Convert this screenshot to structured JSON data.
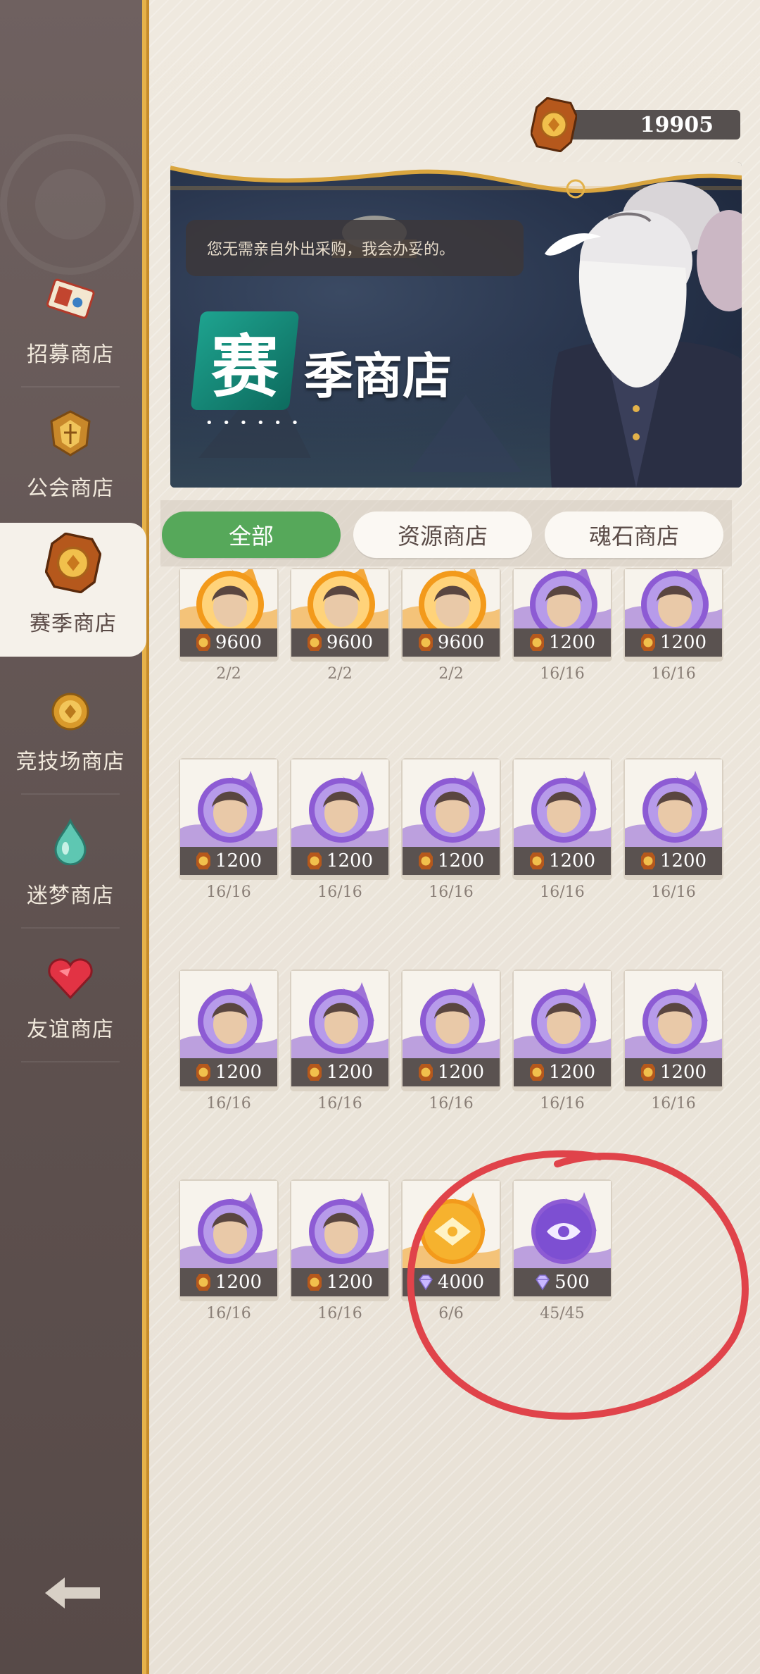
{
  "currency": {
    "amount": "19905",
    "icon": "season-coin-icon"
  },
  "sidebar": {
    "items": [
      {
        "label": "招募商店",
        "icon": "ticket-icon",
        "active": false
      },
      {
        "label": "公会商店",
        "icon": "guild-emblem-icon",
        "active": false
      },
      {
        "label": "赛季商店",
        "icon": "season-coin-icon",
        "active": true
      },
      {
        "label": "竞技场商店",
        "icon": "arena-coin-icon",
        "active": false
      },
      {
        "label": "迷梦商店",
        "icon": "dream-drop-icon",
        "active": false
      },
      {
        "label": "友谊商店",
        "icon": "heart-gem-icon",
        "active": false
      }
    ],
    "back_icon": "back-arrow-icon"
  },
  "banner": {
    "speech": "您无需亲自外出采购，我会办妥的。",
    "title_badge": "赛",
    "title_rest": "季商店",
    "dots": "• • • • • •"
  },
  "tabs": [
    {
      "label": "全部",
      "active": true
    },
    {
      "label": "资源商店",
      "active": false
    },
    {
      "label": "魂石商店",
      "active": false
    }
  ],
  "items": [
    {
      "price": "9600",
      "stock": "2/2",
      "style": "fire",
      "currency": "coin",
      "portrait": "panda"
    },
    {
      "price": "9600",
      "stock": "2/2",
      "style": "fire",
      "currency": "coin",
      "portrait": "masked-elf"
    },
    {
      "price": "9600",
      "stock": "2/2",
      "style": "fire",
      "currency": "coin",
      "portrait": "dark-hair-hero"
    },
    {
      "price": "1200",
      "stock": "16/16",
      "style": "purple",
      "currency": "coin",
      "portrait": "dark-hair-man"
    },
    {
      "price": "1200",
      "stock": "16/16",
      "style": "purple",
      "currency": "coin",
      "portrait": "stone-golem"
    },
    {
      "price": "1200",
      "stock": "16/16",
      "style": "purple",
      "currency": "coin",
      "portrait": "blonde-girl"
    },
    {
      "price": "1200",
      "stock": "16/16",
      "style": "purple",
      "currency": "coin",
      "portrait": "blonde-man"
    },
    {
      "price": "1200",
      "stock": "16/16",
      "style": "purple",
      "currency": "coin",
      "portrait": "old-warrior"
    },
    {
      "price": "1200",
      "stock": "16/16",
      "style": "purple",
      "currency": "coin",
      "portrait": "dwarf"
    },
    {
      "price": "1200",
      "stock": "16/16",
      "style": "purple",
      "currency": "coin",
      "portrait": "pale-lady"
    },
    {
      "price": "1200",
      "stock": "16/16",
      "style": "purple",
      "currency": "coin",
      "portrait": "hooded-elder"
    },
    {
      "price": "1200",
      "stock": "16/16",
      "style": "purple",
      "currency": "coin",
      "portrait": "tree-spirit"
    },
    {
      "price": "1200",
      "stock": "16/16",
      "style": "purple",
      "currency": "coin",
      "portrait": "brown-hair-lady"
    },
    {
      "price": "1200",
      "stock": "16/16",
      "style": "purple",
      "currency": "coin",
      "portrait": "white-wolf"
    },
    {
      "price": "1200",
      "stock": "16/16",
      "style": "purple",
      "currency": "coin",
      "portrait": "grey-sage"
    },
    {
      "price": "1200",
      "stock": "16/16",
      "style": "purple",
      "currency": "coin",
      "portrait": "goggles-girl"
    },
    {
      "price": "1200",
      "stock": "16/16",
      "style": "purple",
      "currency": "coin",
      "portrait": "white-hair-elf"
    },
    {
      "price": "4000",
      "stock": "6/6",
      "style": "fire",
      "currency": "diamond",
      "portrait": "gold-orb"
    },
    {
      "price": "500",
      "stock": "45/45",
      "style": "purple",
      "currency": "diamond",
      "portrait": "purple-orb"
    }
  ],
  "colors": {
    "sidebar_bg": "#5e514f",
    "sidebar_border": "#e6b24a",
    "active_tab": "#56a85a",
    "price_bar": "#5a5250",
    "annotation_circle": "#e0434a",
    "purple_accent": "#8d5bd4",
    "fire_accent": "#f39a1b"
  }
}
